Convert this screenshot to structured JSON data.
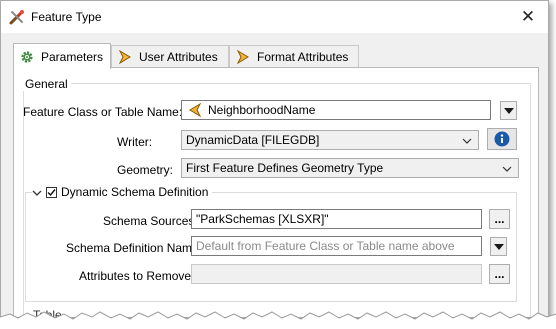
{
  "window": {
    "title": "Feature Type",
    "close_glyph": "✕",
    "icon": "fme-transformer-icon"
  },
  "tabs": [
    {
      "label": "Parameters",
      "icon": "gear-icon",
      "active": true
    },
    {
      "label": "User Attributes",
      "icon": "attribute-arrow-icon",
      "active": false
    },
    {
      "label": "Format Attributes",
      "icon": "attribute-arrow-icon",
      "active": false
    }
  ],
  "general": {
    "legend": "General",
    "feature_class": {
      "label": "Feature Class or Table Name:",
      "value": "NeighborhoodName",
      "icon": "attribute-arrow-icon"
    },
    "writer": {
      "label": "Writer:",
      "value": "DynamicData [FILEGDB]",
      "info_icon": "info-icon"
    },
    "geometry": {
      "label": "Geometry:",
      "value": "First Feature Defines Geometry Type"
    }
  },
  "dynamic_schema": {
    "legend": "Dynamic Schema Definition",
    "checked": true,
    "schema_sources": {
      "label": "Schema Sources:",
      "value": "\"ParkSchemas [XLSXR]\"",
      "button": "..."
    },
    "schema_definition_name": {
      "label": "Schema Definition Name:",
      "placeholder": "Default from Feature Class or Table name above"
    },
    "attributes_to_remove": {
      "label": "Attributes to Remove:",
      "value": "",
      "button": "..."
    }
  },
  "partial_label": "Table",
  "colors": {
    "accent_blue": "#1a5aa6",
    "attr_icon_fill": "#f2b53b",
    "attr_icon_stroke": "#8a5a00",
    "gear_green": "#3f8a3f"
  }
}
